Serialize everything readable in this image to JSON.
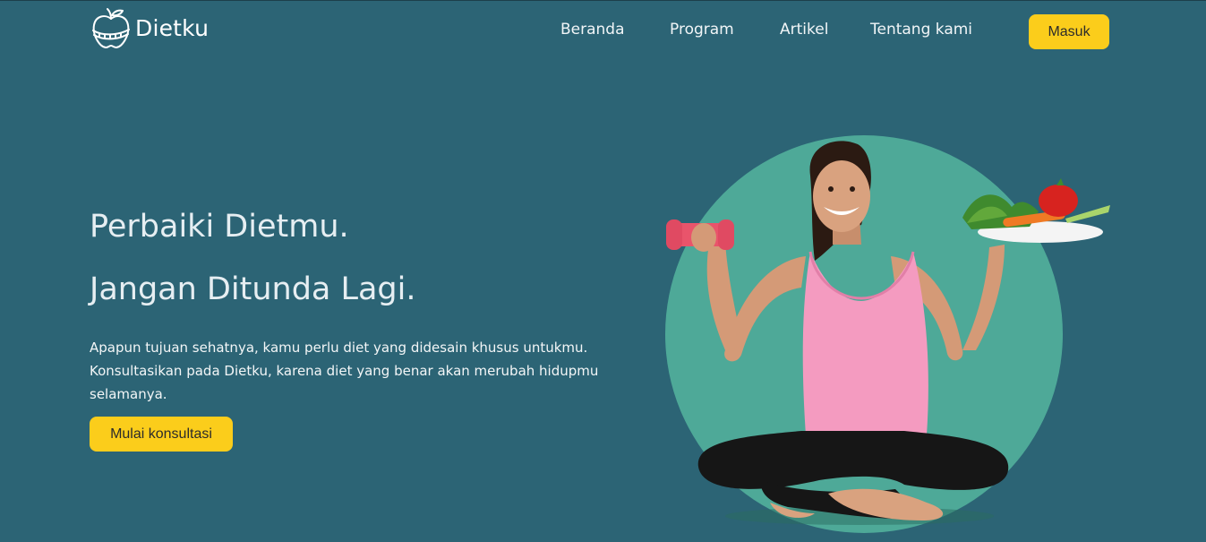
{
  "brand": {
    "name": "Dietku",
    "logo_icon": "apple-measuring-tape-icon"
  },
  "nav": {
    "items": [
      {
        "label": "Beranda"
      },
      {
        "label": "Program"
      },
      {
        "label": "Artikel"
      },
      {
        "label": "Tentang kami"
      }
    ],
    "login_label": "Masuk"
  },
  "hero": {
    "title_line1": "Perbaiki Dietmu.",
    "title_line2": "Jangan Ditunda Lagi.",
    "description": "Apapun tujuan sehatnya, kamu perlu diet yang didesain khusus untukmu. Konsultasikan pada Dietku, karena diet yang benar akan merubah hidupmu selamanya.",
    "cta_label": "Mulai konsultasi",
    "image": "woman-holding-dumbbell-and-vegetable-plate"
  },
  "colors": {
    "background": "#2c6475",
    "accent": "#fbcd1b",
    "circle": "#4ea998"
  }
}
